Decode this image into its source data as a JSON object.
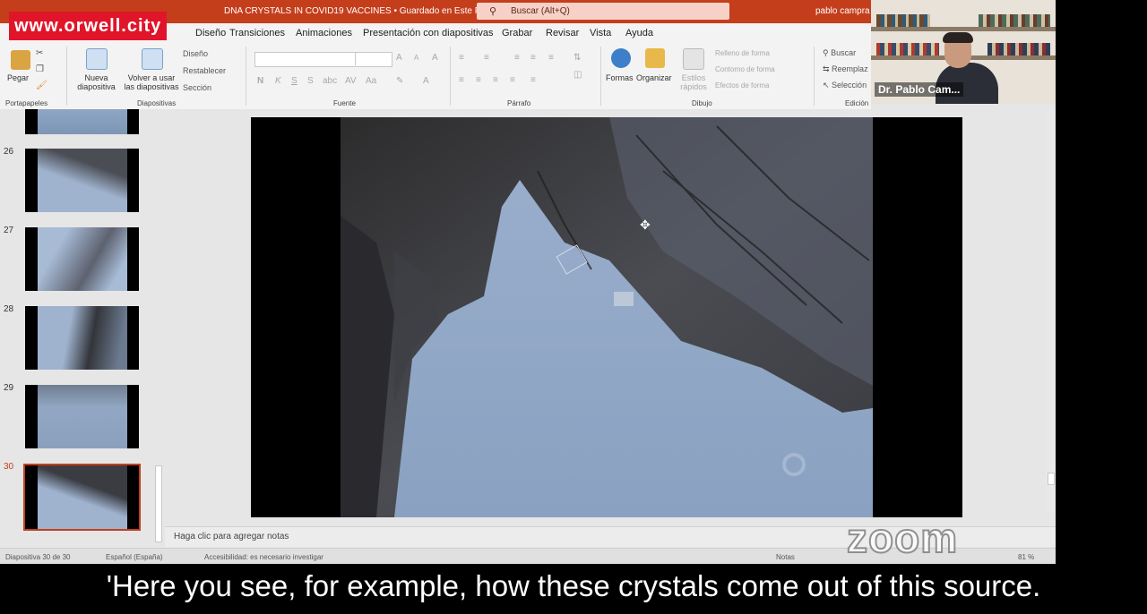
{
  "watermark": "www.orwell.city",
  "titlebar": {
    "document": "DNA CRYSTALS IN COVID19 VACCINES • Guardado en Este PC",
    "search_placeholder": "Buscar (Alt+Q)",
    "user": "pablo campra"
  },
  "tabs": [
    "Diseño",
    "Transiciones",
    "Animaciones",
    "Presentación con diapositivas",
    "Grabar",
    "Revisar",
    "Vista",
    "Ayuda"
  ],
  "ribbon": {
    "paste": "Pegar",
    "new_slide": [
      "Nueva",
      "diapositiva"
    ],
    "reuse_slides": [
      "Volver a usar",
      "las diapositivas"
    ],
    "layout": "Diseño",
    "reset": "Restablecer",
    "section": "Sección",
    "shapes": "Formas",
    "arrange": "Organizar",
    "quick_styles": [
      "Estilos",
      "rápidos"
    ],
    "shape_fill": "Relleno de forma",
    "shape_outline": "Contorno de forma",
    "shape_effects": "Efectos de forma",
    "find": "Buscar",
    "replace": "Reemplaz",
    "select": "Selección",
    "groups": {
      "clipboard": "Portapapeles",
      "slides": "Diapositivas",
      "font": "Fuente",
      "paragraph": "Párrafo",
      "drawing": "Dibujo",
      "editing": "Edición"
    }
  },
  "thumbnails": [
    {
      "number": "26",
      "selected": false
    },
    {
      "number": "27",
      "selected": false
    },
    {
      "number": "28",
      "selected": false
    },
    {
      "number": "29",
      "selected": false
    },
    {
      "number": "30",
      "selected": true
    }
  ],
  "notes_placeholder": "Haga clic para agregar notas",
  "statusbar": {
    "slide_count": "Diapositiva 30 de 30",
    "language": "Español (España)",
    "accessibility": "Accesibilidad: es necesario investigar",
    "notes": "Notas",
    "zoom": "81 %"
  },
  "webcam": {
    "name": "Dr. Pablo Cam..."
  },
  "zoom_logo": "zoom",
  "subtitle": "'Here you see, for example, how these crystals come out of this source."
}
